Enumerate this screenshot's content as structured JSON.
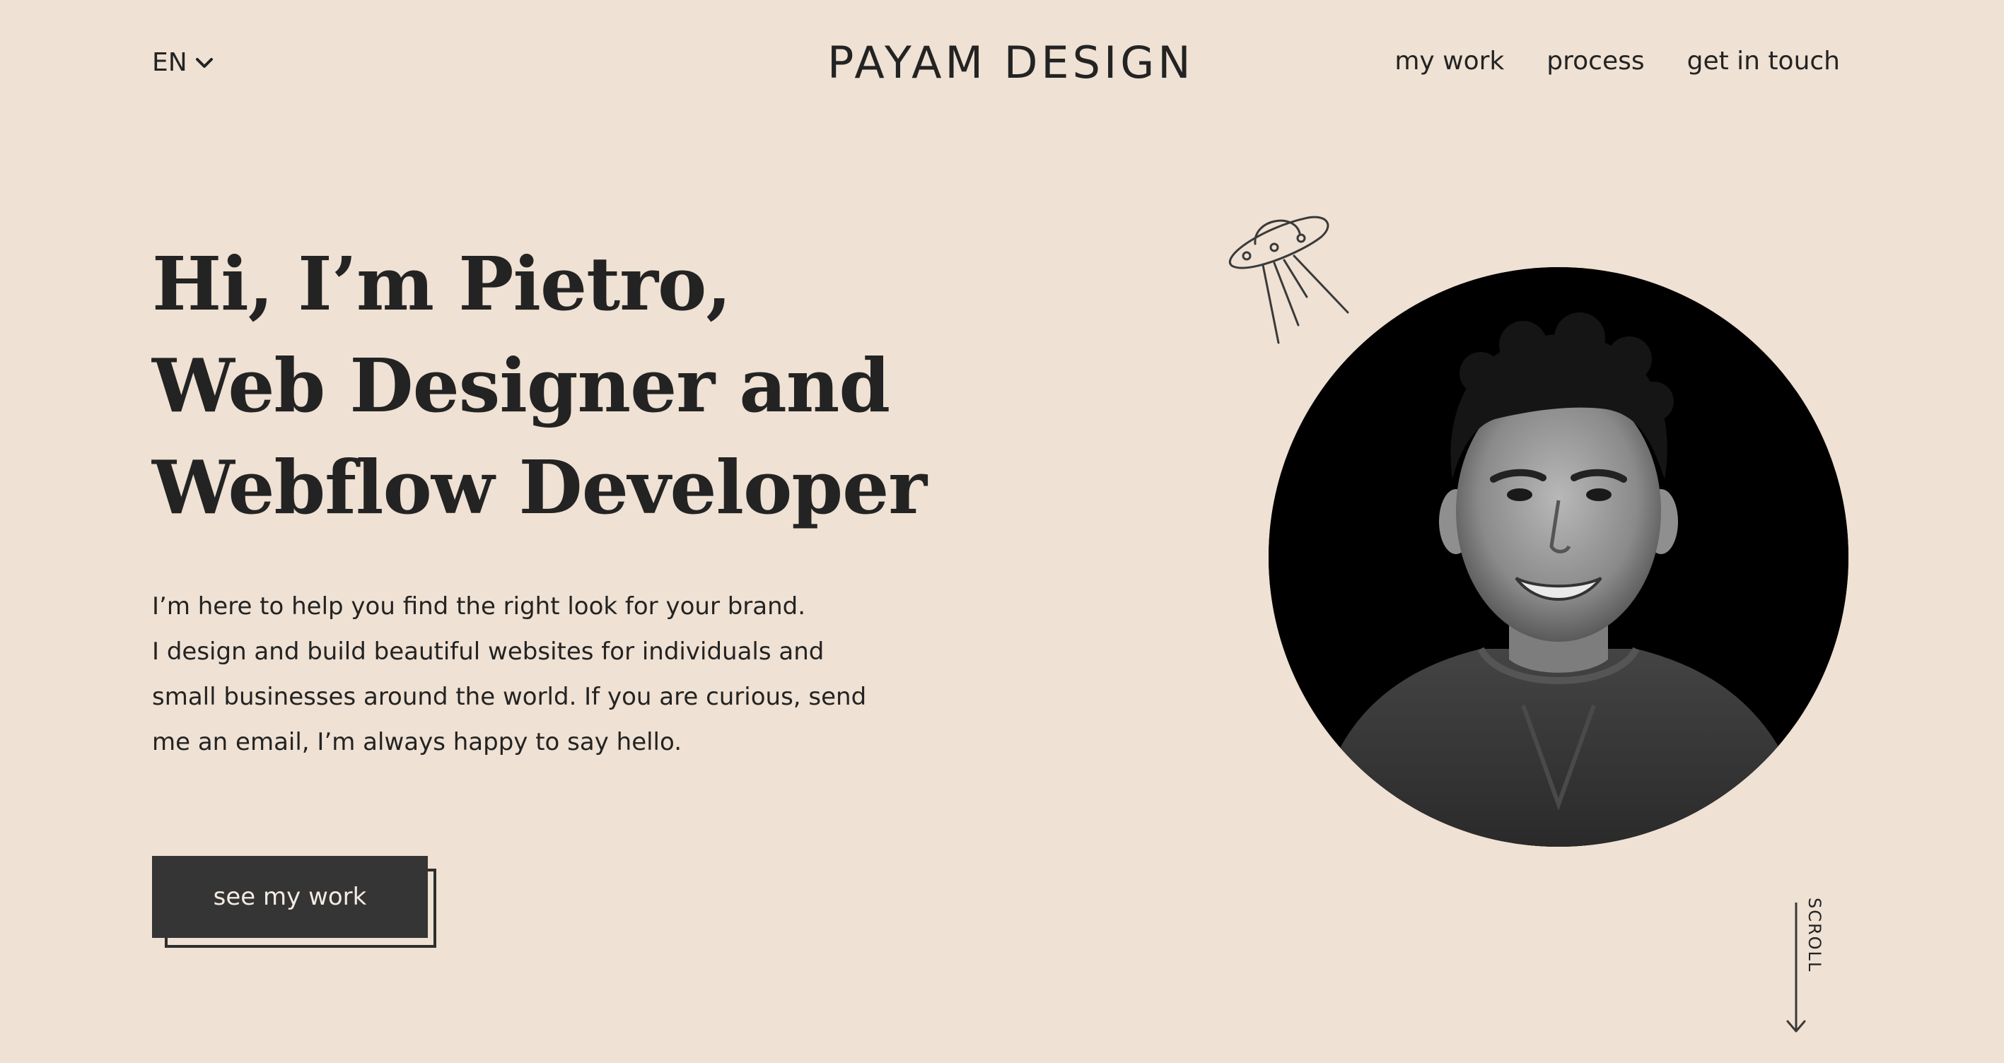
{
  "header": {
    "language": "EN",
    "brand": "PAYAM DESIGN",
    "nav": [
      {
        "label": "my work"
      },
      {
        "label": "process"
      },
      {
        "label": "get in touch"
      }
    ]
  },
  "hero": {
    "heading_lines": [
      "Hi, I’m Pietro,",
      "Web Designer and",
      "Webflow Developer"
    ],
    "intro_lines": [
      "I’m here to help you find the right look for your brand.",
      "I design and build beautiful websites for individuals and",
      "small businesses around the world. If you are curious, send",
      "me an email, I’m always happy to say hello."
    ],
    "cta_label": "see my work"
  },
  "scroll_label": "SCROLL",
  "icons": {
    "language_toggle": "chevron-down-icon",
    "decoration": "ufo-icon",
    "scroll": "arrow-down-icon"
  },
  "colors": {
    "background": "#EFE1D3",
    "text": "#232323",
    "button": "#353535",
    "button_text": "#F3EBE2"
  }
}
